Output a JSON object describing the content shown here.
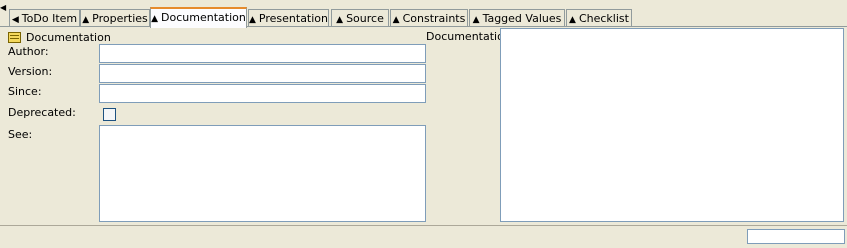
{
  "tabs": [
    {
      "label": "ToDo Item",
      "arrow": "◀",
      "active": false
    },
    {
      "label": "Properties",
      "arrow": "▲",
      "active": false
    },
    {
      "label": "Documentation",
      "arrow": "▲",
      "active": true
    },
    {
      "label": "Presentation",
      "arrow": "▲",
      "active": false
    },
    {
      "label": "Source",
      "arrow": "▲",
      "active": false
    },
    {
      "label": "Constraints",
      "arrow": "▲",
      "active": false
    },
    {
      "label": "Tagged Values",
      "arrow": "▲",
      "active": false
    },
    {
      "label": "Checklist",
      "arrow": "▲",
      "active": false
    }
  ],
  "panel": {
    "section_title": "Documentation",
    "author_label": "Author:",
    "author_value": "",
    "version_label": "Version:",
    "version_value": "",
    "since_label": "Since:",
    "since_value": "",
    "deprecated_label": "Deprecated:",
    "deprecated_checked": false,
    "see_label": "See:",
    "see_value": "",
    "documentation_label": "Documentation:",
    "documentation_value": ""
  },
  "status": {
    "field_value": ""
  },
  "icons": {
    "collapse": "triangle-left-icon",
    "section": "documentation-icon"
  },
  "colors": {
    "background": "#ece9d8",
    "active_tab_accent": "#e68b2c",
    "field_border": "#7f9db9"
  }
}
